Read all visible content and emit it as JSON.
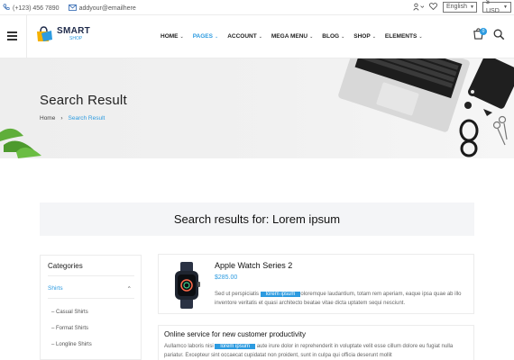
{
  "topbar": {
    "phone": "(+123) 456 7890",
    "email": "addyour@emailhere",
    "language": "English",
    "currency": "$ USD"
  },
  "logo": {
    "line1": "SMART",
    "line2": "SHOP"
  },
  "nav": [
    "HOME",
    "PAGES",
    "ACCOUNT",
    "MEGA MENU",
    "BLOG",
    "SHOP",
    "ELEMENTS"
  ],
  "cart": {
    "count": "0"
  },
  "hero": {
    "title": "Search Result",
    "breadcrumb": {
      "home": "Home",
      "separator": "›",
      "current": "Search Result"
    }
  },
  "results": {
    "heading": "Search results for: Lorem ipsum"
  },
  "sidebar": {
    "title": "Categories",
    "category": "Shirts",
    "items": [
      "Casual Shirts",
      "Format Shirts",
      "Longline Shirts"
    ]
  },
  "product": {
    "name": "Apple Watch Series 2",
    "price": "$285.00",
    "desc_before": "Sed ut perspiciatis",
    "highlight": "lorem ipsum",
    "desc_after": "oloremque laudantium, totam rem aperiam, eaque ipsa quae ab illo inventore veritatis et quasi architecto beatae vitae dicta uptatem sequi nesciunt."
  },
  "post": {
    "title": "Online service for new customer productivity",
    "desc_before": "Aullamco laboris nisi",
    "highlight": "lorem ipsum",
    "desc_after": "aute irure dolor in reprehenderit in voluptate velit esse cillum dolore eu fugiat nulla pariatur. Excepteur sint occaecat cupidatat non proident, sunt in culpa qui officia deserunt mollit"
  },
  "colors": {
    "accent": "#2d9be0",
    "dark": "#1e2a4a",
    "banner_bg": "#f4f5f7"
  }
}
